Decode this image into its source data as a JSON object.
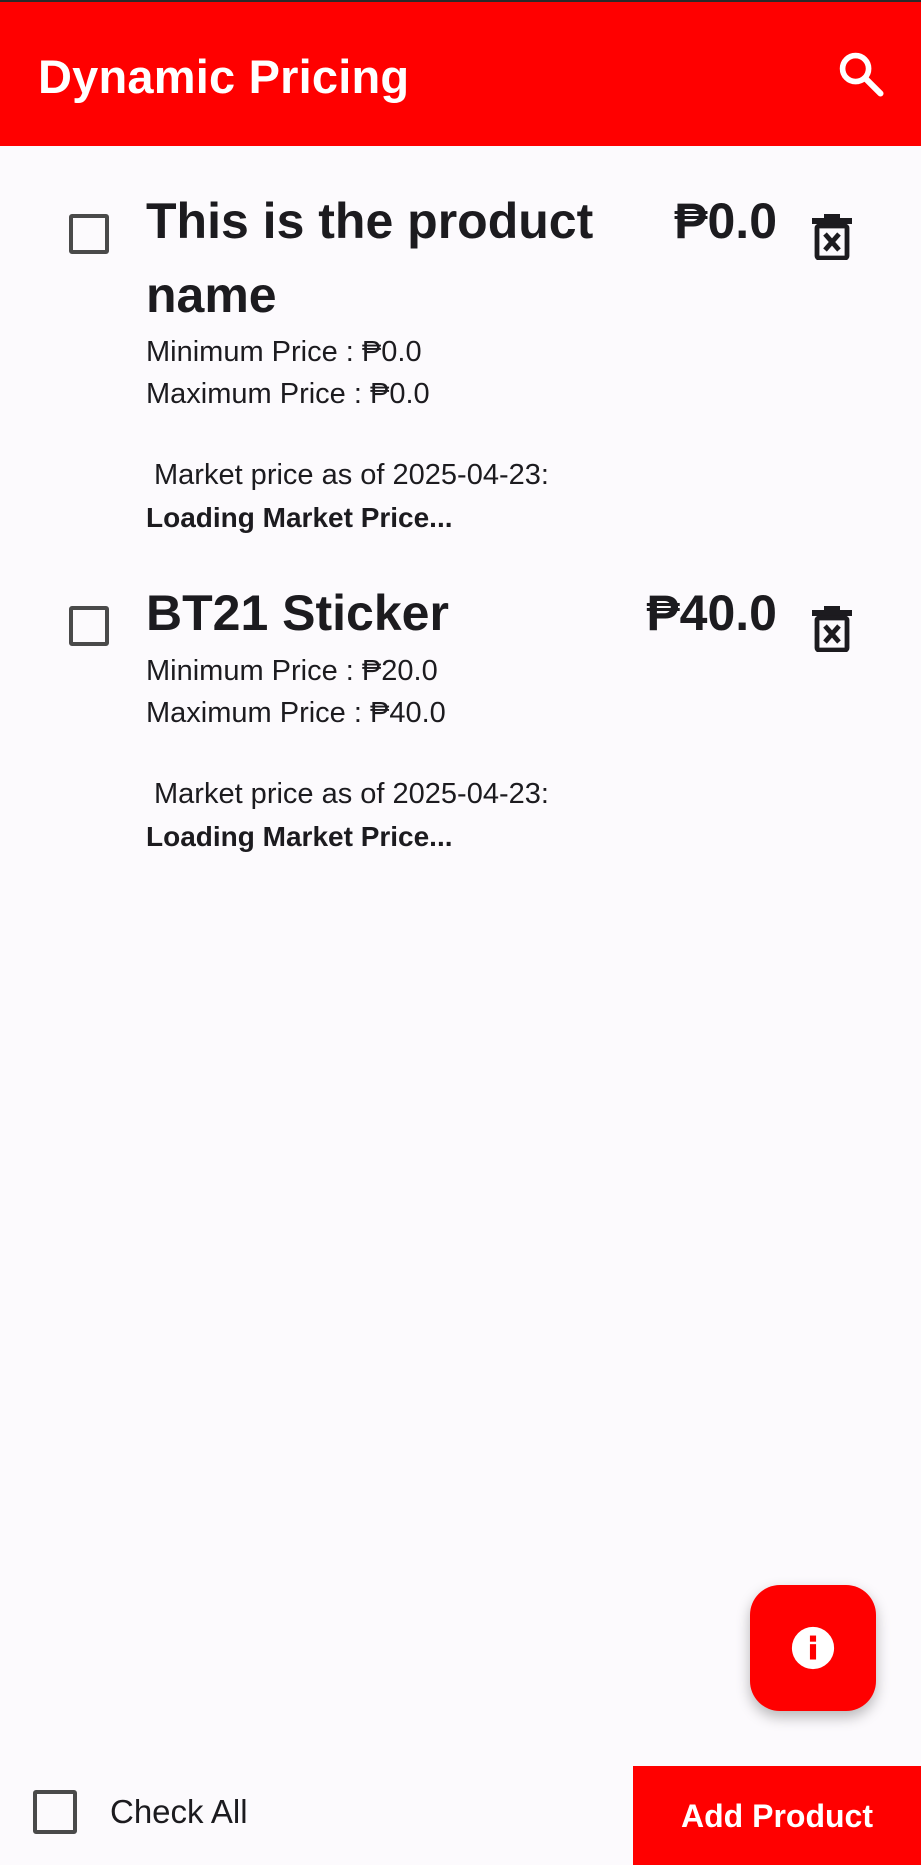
{
  "app_bar": {
    "title": "Dynamic Pricing",
    "search_icon": "search-icon",
    "background": "#ff0000"
  },
  "products": [
    {
      "name": "This is the product name",
      "price": "₱0.0",
      "min_price": "Minimum Price : ₱0.0",
      "max_price": "Maximum Price : ₱0.0",
      "market_label": "Market price as of 2025-04-23:",
      "market_value": "Loading Market Price...",
      "checked": false,
      "delete_icon": "delete-icon"
    },
    {
      "name": "BT21 Sticker",
      "price": "₱40.0",
      "min_price": "Minimum Price : ₱20.0",
      "max_price": "Maximum Price : ₱40.0",
      "market_label": "Market price as of 2025-04-23:",
      "market_value": "Loading Market Price...",
      "checked": false,
      "delete_icon": "delete-icon"
    }
  ],
  "fab": {
    "icon": "info-icon"
  },
  "bottom_bar": {
    "check_all_label": "Check All",
    "check_all_checked": false,
    "add_button_label": "Add Product"
  },
  "colors": {
    "accent": "#ff0000",
    "background": "#fcfafd",
    "text": "#1c1b1f"
  }
}
